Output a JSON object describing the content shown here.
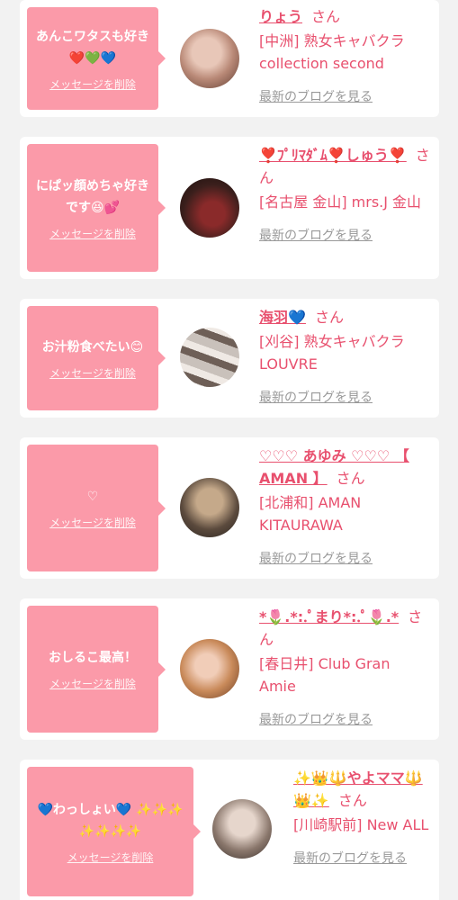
{
  "items": [
    {
      "message": "あんこワタスも好き❤️💚💙",
      "delete_label": "メッセージを削除",
      "name": "りょう",
      "honorific": "さん",
      "shop": "[中洲] 熟女キャバクラ collection second",
      "blog_label": "最新のブログを見る"
    },
    {
      "message": "にぱッ顔めちゃ好きです😆💕",
      "delete_label": "メッセージを削除",
      "name": "❣️ﾌﾟﾘﾏﾀﾞﾑ❣️しゅう❣️",
      "honorific": "さん",
      "shop": "[名古屋 金山] mrs.J 金山",
      "blog_label": "最新のブログを見る"
    },
    {
      "message": "お汁粉食べたい😊",
      "delete_label": "メッセージを削除",
      "name": "海羽💙",
      "honorific": "さん",
      "shop": "[刈谷] 熟女キャバクラ LOUVRE",
      "blog_label": "最新のブログを見る"
    },
    {
      "message": "♡",
      "delete_label": "メッセージを削除",
      "name": "♡♡♡ あゆみ ♡♡♡ 【 AMAN 】",
      "honorific": "さん",
      "shop": "[北浦和] AMAN KITAURAWA",
      "blog_label": "最新のブログを見る"
    },
    {
      "message": "おしるこ最高！",
      "delete_label": "メッセージを削除",
      "name": "*🌷.*:.ﾟまり*:.ﾟ🌷.*",
      "honorific": "さん",
      "shop": "[春日井] Club Gran Amie",
      "blog_label": "最新のブログを見る"
    },
    {
      "message": "💙わっしょい💙 ✨✨✨✨✨✨✨",
      "delete_label": "メッセージを削除",
      "name": "✨👑🔱やよママ🔱👑✨",
      "honorific": "さん",
      "shop": "[川崎駅前] New ALL",
      "blog_label": "最新のブログを見る"
    }
  ]
}
